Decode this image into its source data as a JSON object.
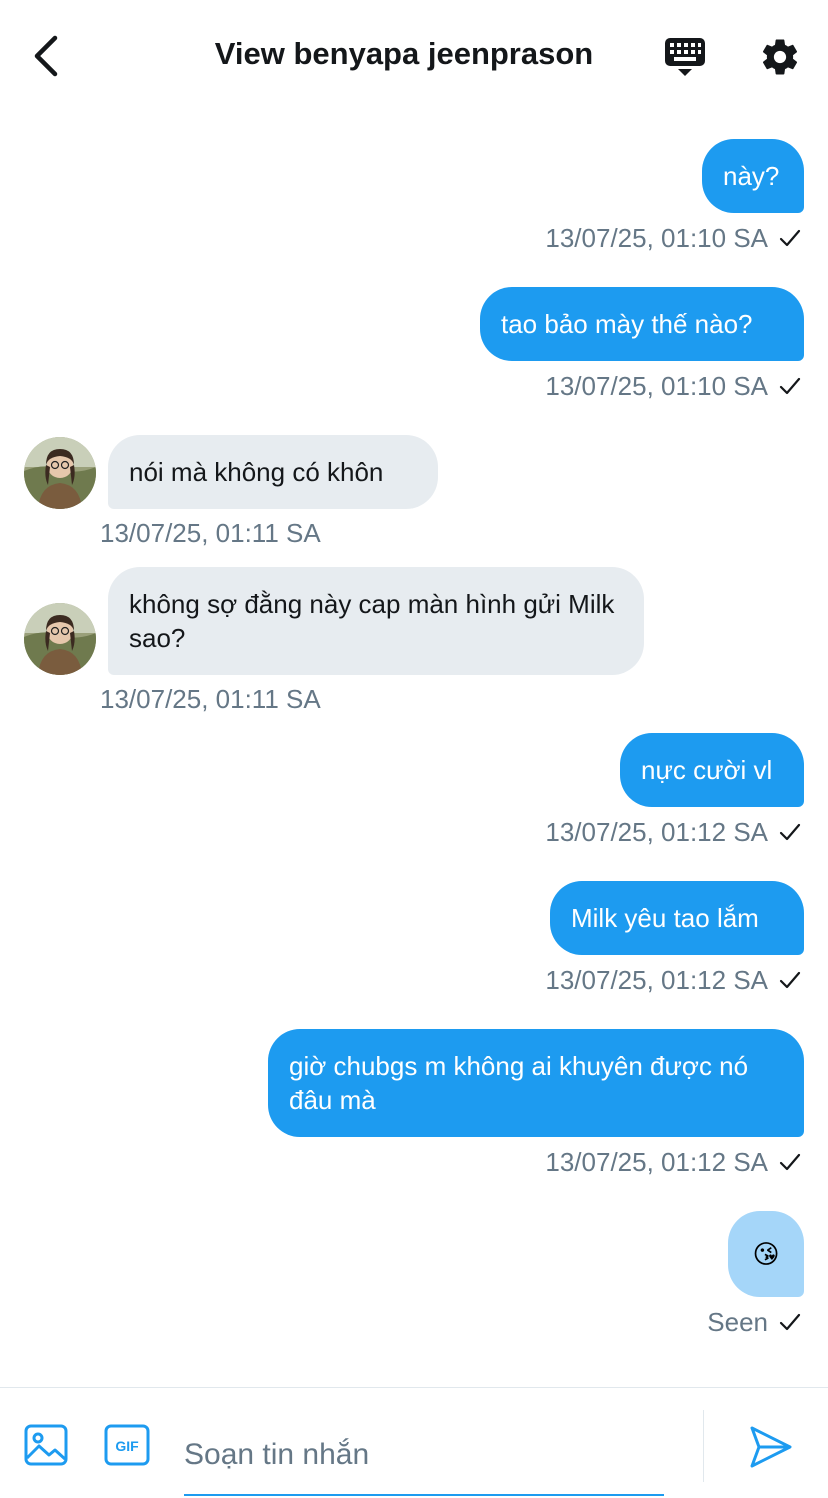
{
  "header": {
    "title": "View benyapa jeenprason"
  },
  "messages": [
    {
      "text": "này?",
      "time": "13/07/25, 01:10 SA"
    },
    {
      "text": "tao bảo mày thế nào?",
      "time": "13/07/25, 01:10 SA"
    },
    {
      "text": "nói mà không có khôn",
      "time": "13/07/25, 01:11 SA"
    },
    {
      "text": "không sợ đằng này cap màn hình gửi Milk sao?",
      "time": "13/07/25, 01:11 SA"
    },
    {
      "text": "nực cười vl",
      "time": "13/07/25, 01:12 SA"
    },
    {
      "text": "Milk yêu tao lắm",
      "time": "13/07/25, 01:12 SA"
    },
    {
      "text": "giờ chubgs m không ai khuyên được nó đâu mà",
      "time": "13/07/25, 01:12 SA"
    },
    {
      "text": "😘",
      "time": "Seen"
    }
  ],
  "composer": {
    "placeholder": "Soạn tin nhắn"
  },
  "colors": {
    "accent": "#1d9bf0",
    "incoming_bubble": "#e7ecf0",
    "emoji_bubble": "#a5d6f9",
    "meta_text": "#657786"
  },
  "icons": [
    "back-arrow-icon",
    "keyboard-icon",
    "gear-icon",
    "image-icon",
    "gif-icon",
    "send-icon",
    "checkmark-icon"
  ]
}
